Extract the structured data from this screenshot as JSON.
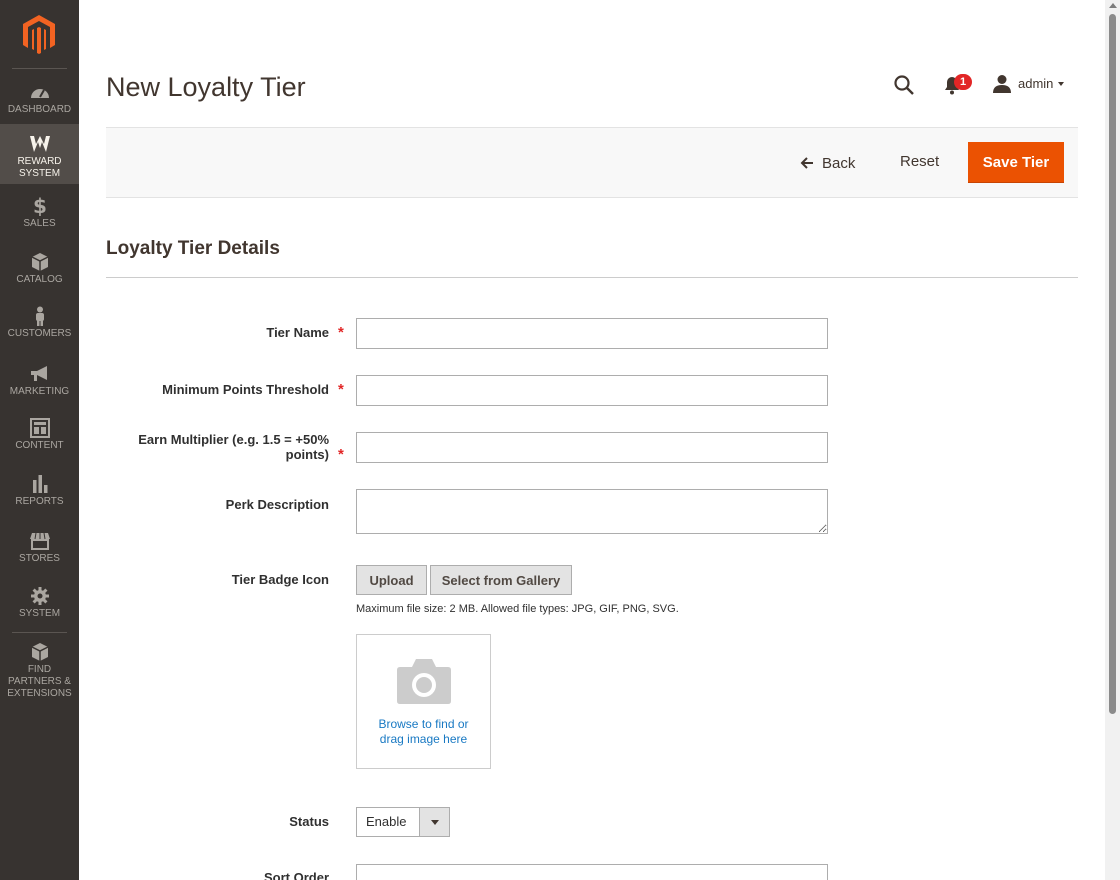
{
  "sidebar": {
    "items": [
      {
        "label": "DASHBOARD"
      },
      {
        "label": "REWARD SYSTEM"
      },
      {
        "label": "SALES"
      },
      {
        "label": "CATALOG"
      },
      {
        "label": "CUSTOMERS"
      },
      {
        "label": "MARKETING"
      },
      {
        "label": "CONTENT"
      },
      {
        "label": "REPORTS"
      },
      {
        "label": "STORES"
      },
      {
        "label": "SYSTEM"
      },
      {
        "label": "FIND PARTNERS & EXTENSIONS"
      }
    ],
    "active_item": "REWARD SYSTEM"
  },
  "header": {
    "title": "New Loyalty Tier",
    "notification_count": "1",
    "username": "admin"
  },
  "actions": {
    "back_label": "Back",
    "reset_label": "Reset",
    "save_label": "Save Tier"
  },
  "section": {
    "title": "Loyalty Tier Details"
  },
  "form": {
    "tier_name": {
      "label": "Tier Name",
      "required": true,
      "value": ""
    },
    "min_points": {
      "label": "Minimum Points Threshold",
      "required": true,
      "value": ""
    },
    "earn_multiplier": {
      "label_line1": "Earn Multiplier (e.g. 1.5 = +50%",
      "label_line2": "points)",
      "required": true,
      "value": ""
    },
    "perk_description": {
      "label": "Perk Description",
      "value": ""
    },
    "badge_icon": {
      "label": "Tier Badge Icon",
      "upload_label": "Upload",
      "gallery_label": "Select from Gallery",
      "note": "Maximum file size: 2 MB. Allowed file types: JPG, GIF, PNG, SVG.",
      "drop_line1": "Browse to find or",
      "drop_line2": "drag image here"
    },
    "status": {
      "label": "Status",
      "value": "Enable"
    },
    "sort_order": {
      "label": "Sort Order",
      "value": ""
    }
  },
  "colors": {
    "sidebar_bg": "#373330",
    "accent": "#eb5202",
    "link": "#1979c3",
    "required": "#e22626"
  },
  "icons": [
    "magento-logo-icon",
    "dashboard-icon",
    "reward-system-icon",
    "dollar-icon",
    "catalog-box-icon",
    "customer-person-icon",
    "megaphone-icon",
    "content-icon",
    "reports-icon",
    "stores-icon",
    "gear-icon",
    "partners-box-icon",
    "search-icon",
    "bell-icon",
    "user-icon",
    "back-arrow-icon",
    "camera-icon"
  ]
}
